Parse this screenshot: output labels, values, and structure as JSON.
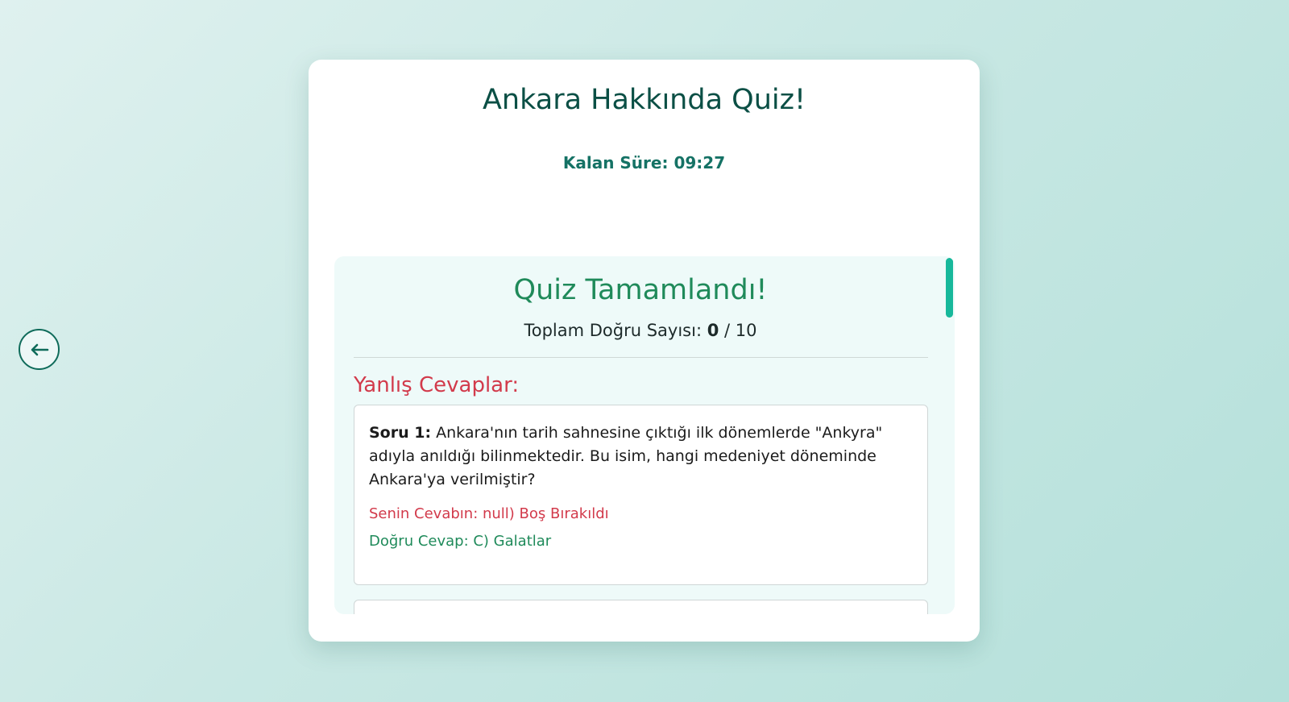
{
  "back_button": {
    "icon": "arrow-left-icon"
  },
  "quiz": {
    "title": "Ankara Hakkında Quiz!",
    "timer_label": "Kalan Süre:",
    "timer_value": "09:27"
  },
  "result": {
    "title": "Quiz Tamamlandı!",
    "score_label": "Toplam Doğru Sayısı:",
    "score_correct": "0",
    "score_total": "/ 10",
    "wrong_heading": "Yanlış Cevaplar:",
    "wrong_answers": [
      {
        "number_label": "Soru 1:",
        "question": "Ankara'nın tarih sahnesine çıktığı ilk dönemlerde \"Ankyra\" adıyla anıldığı bilinmektedir. Bu isim, hangi medeniyet döneminde Ankara'ya verilmiştir?",
        "your_answer": "Senin Cevabın: null) Boş Bırakıldı",
        "correct_answer": "Doğru Cevap: C) Galatlar"
      }
    ]
  },
  "colors": {
    "accent": "#0f6b5a",
    "correct": "#1f8a5a",
    "wrong": "#d23a4b",
    "scrollbar": "#17b89b"
  }
}
